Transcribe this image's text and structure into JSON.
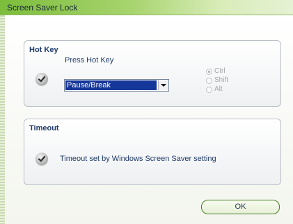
{
  "window": {
    "title": "Screen Saver Lock"
  },
  "hotkey_group": {
    "label": "Hot Key",
    "prompt": "Press Hot Key",
    "check_icon": "check-icon",
    "selected_key": "Pause/Break",
    "modifiers": [
      {
        "label": "Ctrl",
        "checked": true
      },
      {
        "label": "Shift",
        "checked": false
      },
      {
        "label": "Alt",
        "checked": false
      }
    ]
  },
  "timeout_group": {
    "label": "Timeout",
    "message": "Timeout set by Windows Screen Saver setting",
    "check_icon": "check-icon"
  },
  "buttons": {
    "ok_label": "OK"
  },
  "colors": {
    "title_bar": "#7cbd3b",
    "selection": "#16379a",
    "button_border": "#467a21"
  }
}
